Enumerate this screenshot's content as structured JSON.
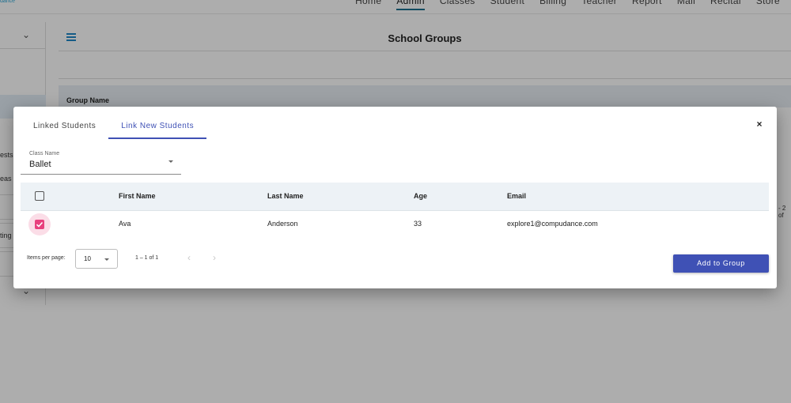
{
  "app": {
    "logo_fragment": "dance",
    "nav": [
      "Home",
      "Admin",
      "Classes",
      "Student",
      "Billing",
      "Teacher",
      "Report",
      "Mail",
      "Recital",
      "Store"
    ],
    "active_nav": "Admin"
  },
  "sidebar": {
    "fragment_1": "ests",
    "fragment_2": "eas",
    "fragment_3": "ting"
  },
  "page": {
    "title": "School Groups",
    "column_group_name": "Group Name",
    "paging_fragment": "- 2 of"
  },
  "modal": {
    "tabs": [
      {
        "label": "Linked Students",
        "active": false
      },
      {
        "label": "Link New Students",
        "active": true
      }
    ],
    "close_label": "×",
    "class_select": {
      "label": "Class Name",
      "value": "Ballet"
    },
    "table": {
      "headers": {
        "first_name": "First Name",
        "last_name": "Last Name",
        "age": "Age",
        "email": "Email"
      },
      "rows": [
        {
          "selected": true,
          "first_name": "Ava",
          "last_name": "Anderson",
          "age": "33",
          "email": "explore1@compudance.com"
        }
      ]
    },
    "paginator": {
      "items_per_page_label": "Items per page:",
      "page_size": "10",
      "range_label": "1 – 1 of 1"
    },
    "add_button_label": "Add to Group"
  },
  "colors": {
    "primary": "#3f51b5",
    "checkbox_accent": "#e8417e",
    "table_header_bg": "#edf2f6"
  }
}
